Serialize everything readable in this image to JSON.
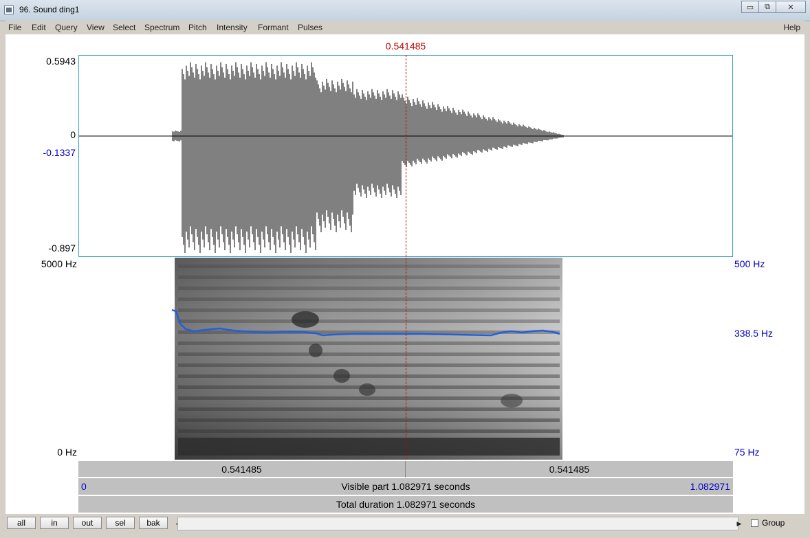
{
  "window": {
    "title": "96. Sound ding1",
    "minimize": "▭",
    "maximize": "⧉",
    "close": "✕"
  },
  "menu": {
    "items": [
      "File",
      "Edit",
      "Query",
      "View",
      "Select",
      "Spectrum",
      "Pitch",
      "Intensity",
      "Formant",
      "Pulses"
    ],
    "help": "Help"
  },
  "cursor": {
    "time_label": "0.541485"
  },
  "waveform": {
    "y_max": "0.5943",
    "y_zero": "0",
    "y_cursor": "-0.1337",
    "y_min": "-0.897"
  },
  "spectrogram": {
    "freq_top": "5000 Hz",
    "freq_bottom": "0 Hz"
  },
  "pitch": {
    "top": "500 Hz",
    "value": "338.5 Hz",
    "bottom": "75 Hz",
    "line_color": "#1f5fe0"
  },
  "timebar": {
    "left": "0.541485",
    "right": "0.541485"
  },
  "visible": {
    "start": "0",
    "label": "Visible part 1.082971 seconds",
    "end": "1.082971"
  },
  "total": {
    "label": "Total duration 1.082971 seconds"
  },
  "buttons": {
    "all": "all",
    "in": "in",
    "out": "out",
    "sel": "sel",
    "bak": "bak"
  },
  "group": {
    "label": "Group",
    "checked": false
  },
  "colors": {
    "cursor": "#c00000",
    "axis_blue": "#0000c8",
    "frame": "#3aa0c8"
  },
  "icons": {
    "app": "praat-window-icon",
    "left": "scroll-left-arrow-icon",
    "right": "scroll-right-arrow-icon"
  }
}
